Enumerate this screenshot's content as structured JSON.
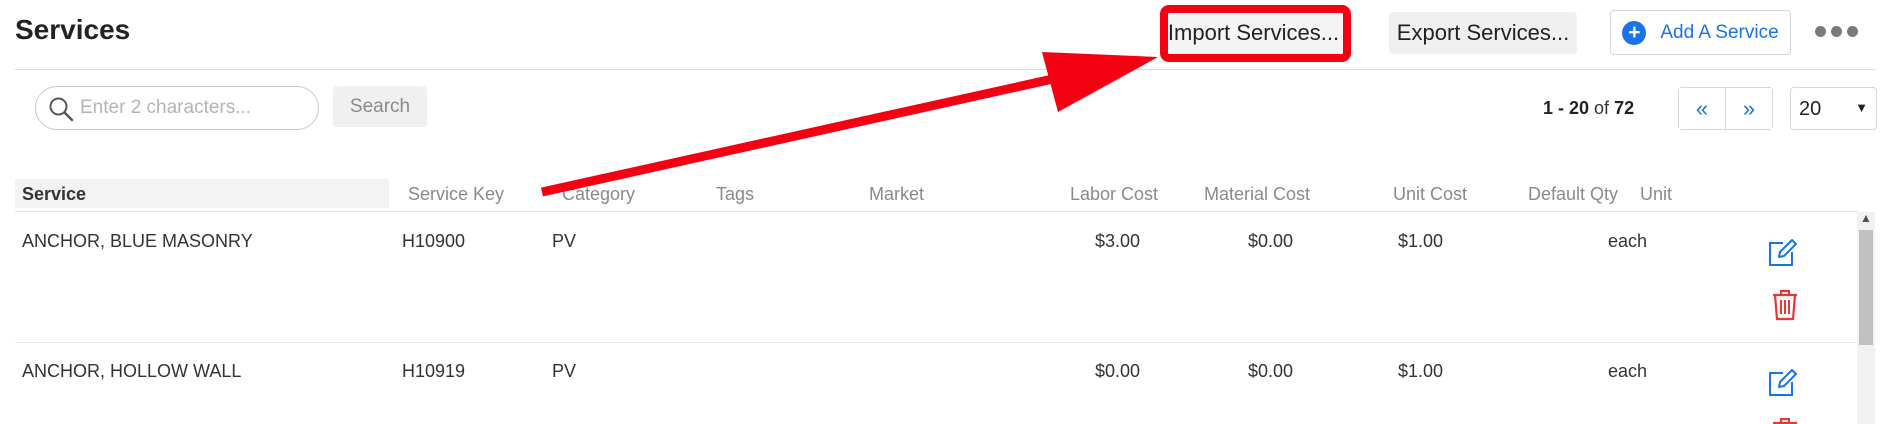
{
  "header": {
    "title": "Services",
    "import_label": "Import Services...",
    "export_label": "Export Services...",
    "add_label": "Add A Service"
  },
  "search": {
    "placeholder": "Enter 2 characters...",
    "value": "",
    "button_label": "Search"
  },
  "pagination": {
    "range": "1 - 20",
    "of_label": "of",
    "total": "72",
    "prev_label": "«",
    "next_label": "»",
    "page_size": "20"
  },
  "table": {
    "columns": [
      "Service",
      "Service Key",
      "Category",
      "Tags",
      "Market",
      "Labor Cost",
      "Material Cost",
      "Unit Cost",
      "Default Qty",
      "Unit"
    ],
    "rows": [
      {
        "service": "ANCHOR, BLUE MASONRY",
        "key": "H10900",
        "category": "PV",
        "tags": "",
        "market": "",
        "labor": "$3.00",
        "material": "$0.00",
        "unit_cost": "$1.00",
        "qty": "",
        "unit": "each"
      },
      {
        "service": "ANCHOR, HOLLOW WALL",
        "key": "H10919",
        "category": "PV",
        "tags": "",
        "market": "",
        "labor": "$0.00",
        "material": "$0.00",
        "unit_cost": "$1.00",
        "qty": "",
        "unit": "each"
      }
    ]
  },
  "icons": {
    "search": "search-icon",
    "add": "plus-circle-icon",
    "more": "more-horizontal-icon",
    "edit": "edit-icon",
    "delete": "trash-icon"
  },
  "colors": {
    "accent": "#1a73e8",
    "annotation": "#f30012",
    "delete": "#e53935"
  }
}
